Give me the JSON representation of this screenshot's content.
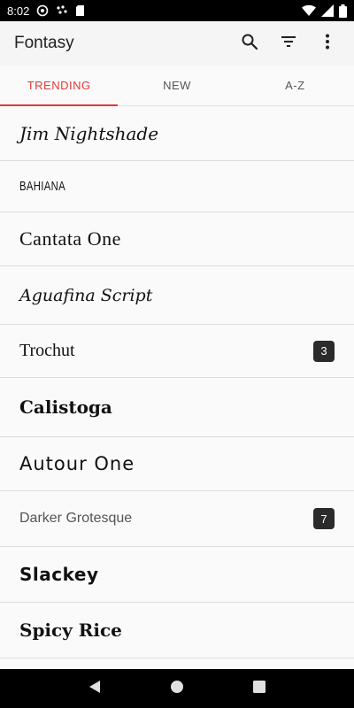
{
  "status_bar": {
    "time": "8:02",
    "icons": [
      "at-sign-icon",
      "dots-icon",
      "sd-card-icon",
      "wifi-icon",
      "signal-icon",
      "battery-icon"
    ]
  },
  "app_bar": {
    "title": "Fontasy",
    "actions": [
      "search-icon",
      "filter-icon",
      "more-vert-icon"
    ]
  },
  "tabs": [
    {
      "label": "TRENDING",
      "active": true
    },
    {
      "label": "NEW",
      "active": false
    },
    {
      "label": "A-Z",
      "active": false
    }
  ],
  "fonts": [
    {
      "name": "Jim Nightshade"
    },
    {
      "name": "BAHIANA"
    },
    {
      "name": "Cantata One"
    },
    {
      "name": "Aguafina Script"
    },
    {
      "name": "Trochut",
      "badge": "3"
    },
    {
      "name": "Calistoga"
    },
    {
      "name": "Autour One"
    },
    {
      "name": "Darker Grotesque",
      "badge": "7"
    },
    {
      "name": "Slackey"
    },
    {
      "name": "Spicy Rice"
    }
  ],
  "nav_bar": {
    "buttons": [
      "back-icon",
      "home-icon",
      "recents-icon"
    ]
  },
  "colors": {
    "accent": "#e53935",
    "badge_bg": "#2b2b2b",
    "status_bar": "#000000"
  }
}
